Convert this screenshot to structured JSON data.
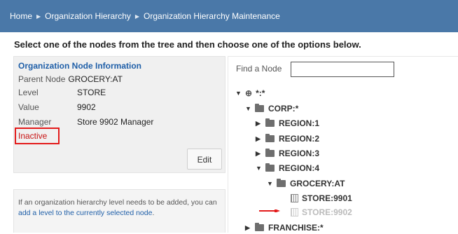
{
  "breadcrumb": [
    "Home",
    "Organization Hierarchy",
    "Organization Hierarchy Maintenance"
  ],
  "instruction": "Select one of the nodes from the tree and then choose one of the options below.",
  "node_info": {
    "title": "Organization Node Information",
    "parent_label": "Parent Node",
    "parent_value": "GROCERY:AT",
    "level_label": "Level",
    "level_value": "STORE",
    "value_label": "Value",
    "value_value": "9902",
    "manager_label": "Manager",
    "manager_value": "Store 9902 Manager",
    "status": "Inactive",
    "edit_label": "Edit"
  },
  "help": {
    "text": "If an organization hierarchy level needs to be added, you can ",
    "link": "add a level to the currently selected node",
    "end": "."
  },
  "tree": {
    "find_label": "Find a Node",
    "find_value": "",
    "nodes": [
      {
        "label": "*:*",
        "toggle": "▼",
        "icon": "globe-icon"
      },
      {
        "label": "CORP:*",
        "toggle": "▼",
        "icon": "folder-icon"
      },
      {
        "label": "REGION:1",
        "toggle": "▶",
        "icon": "folder-icon"
      },
      {
        "label": "REGION:2",
        "toggle": "▶",
        "icon": "folder-icon"
      },
      {
        "label": "REGION:3",
        "toggle": "▶",
        "icon": "folder-icon"
      },
      {
        "label": "REGION:4",
        "toggle": "▼",
        "icon": "folder-icon"
      },
      {
        "label": "GROCERY:AT",
        "toggle": "▼",
        "icon": "folder-icon"
      },
      {
        "label": "STORE:9901",
        "toggle": "",
        "icon": "store-icon"
      },
      {
        "label": "STORE:9902",
        "toggle": "",
        "icon": "store-icon",
        "inactive": true
      },
      {
        "label": "FRANCHISE:*",
        "toggle": "▶",
        "icon": "folder-icon"
      }
    ]
  },
  "colors": {
    "breadcrumb_bg": "#4a78a8",
    "link": "#1f5fa8",
    "highlight": "#e31b1b"
  }
}
